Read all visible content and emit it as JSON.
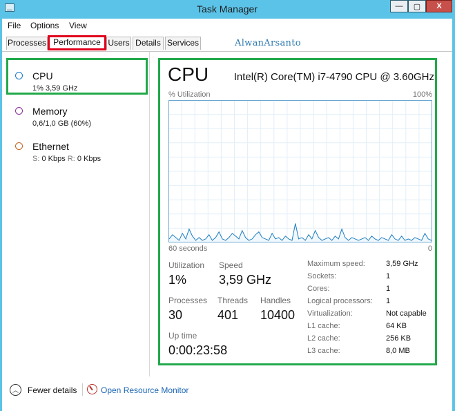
{
  "window": {
    "title": "Task Manager"
  },
  "window_buttons": {
    "minimize": "—",
    "maximize": "▢",
    "close": "X"
  },
  "menu": [
    "File",
    "Options",
    "View"
  ],
  "tabs": [
    "Processes",
    "Performance",
    "Users",
    "Details",
    "Services"
  ],
  "active_tab": "Performance",
  "watermark": "AlwanArsanto",
  "sidebar": {
    "items": [
      {
        "name": "CPU",
        "detail": "1% 3,59 GHz",
        "color": "#1979ca",
        "selected": true
      },
      {
        "name": "Memory",
        "detail": "0,6/1,0 GB (60%)",
        "color": "#8b2d9c"
      },
      {
        "name": "Ethernet",
        "detail_send_label": "S:",
        "detail_send": "0 Kbps",
        "detail_recv_label": "R:",
        "detail_recv": "0 Kbps",
        "color": "#c4621c"
      }
    ]
  },
  "cpu": {
    "heading": "CPU",
    "model": "Intel(R) Core(TM) i7-4790 CPU @ 3.60GHz",
    "graph_label": "% Utilization",
    "graph_max": "100%",
    "graph_time": "60 seconds",
    "graph_min": "0",
    "history": [
      2,
      5,
      3,
      1,
      6,
      2,
      9,
      4,
      1,
      3,
      1,
      2,
      5,
      1,
      3,
      7,
      2,
      1,
      3,
      6,
      4,
      2,
      8,
      3,
      1,
      2,
      5,
      7,
      3,
      2,
      1,
      6,
      2,
      3,
      1,
      4,
      2,
      1,
      13,
      2,
      3,
      1,
      5,
      2,
      8,
      3,
      1,
      2,
      3,
      1,
      4,
      2,
      9,
      3,
      1,
      3,
      2,
      1,
      2,
      3,
      1,
      4,
      2,
      1,
      3,
      2,
      1,
      5,
      2,
      1,
      4,
      1,
      2,
      1,
      3,
      2,
      1,
      6,
      2,
      1
    ],
    "utilization_label": "Utilization",
    "utilization": "1%",
    "speed_label": "Speed",
    "speed": "3,59 GHz",
    "processes_label": "Processes",
    "processes": "30",
    "threads_label": "Threads",
    "threads": "401",
    "handles_label": "Handles",
    "handles": "10400",
    "uptime_label": "Up time",
    "uptime": "0:00:23:58",
    "details": [
      {
        "k": "Maximum speed:",
        "v": "3,59 GHz"
      },
      {
        "k": "Sockets:",
        "v": "1"
      },
      {
        "k": "Cores:",
        "v": "1"
      },
      {
        "k": "Logical processors:",
        "v": "1"
      },
      {
        "k": "Virtualization:",
        "v": "Not capable"
      },
      {
        "k": "L1 cache:",
        "v": "64 KB"
      },
      {
        "k": "L2 cache:",
        "v": "256 KB"
      },
      {
        "k": "L3 cache:",
        "v": "8,0 MB"
      }
    ]
  },
  "footer": {
    "fewer_details": "Fewer details",
    "open_resource_monitor": "Open Resource Monitor"
  }
}
